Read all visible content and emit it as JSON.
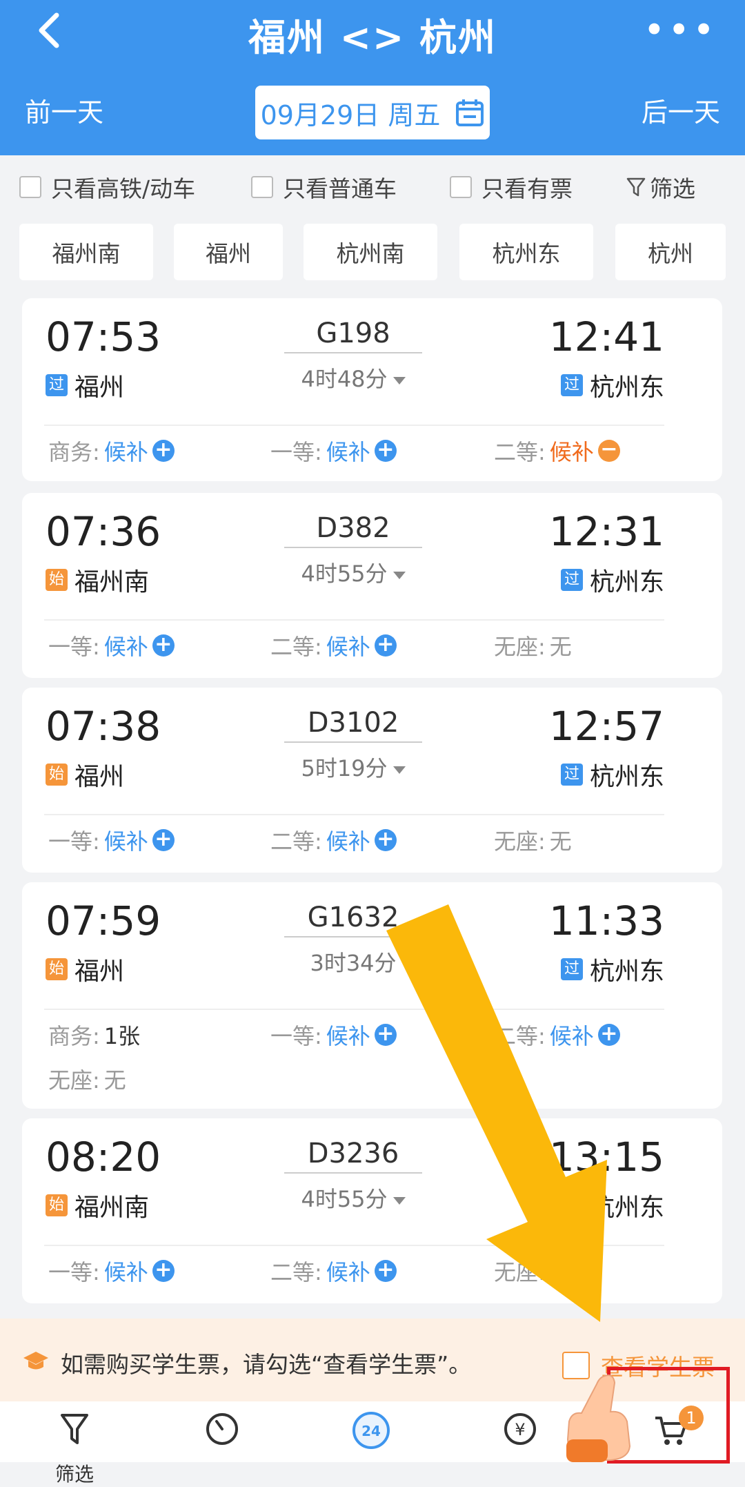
{
  "header": {
    "title": "福州 <> 杭州",
    "prev_day": "前一天",
    "next_day": "后一天",
    "date": "09月29日 周五",
    "accent": "#3d95ee"
  },
  "filters": [
    {
      "label": "只看高铁/动车",
      "checked": false
    },
    {
      "label": "只看普通车",
      "checked": false
    },
    {
      "label": "只看有票",
      "checked": false
    }
  ],
  "filter_button": "筛选",
  "stations": [
    "福州南",
    "福州",
    "杭州南",
    "杭州东",
    "杭州"
  ],
  "trains": [
    {
      "dep_time": "07:53",
      "arr_time": "12:41",
      "train_no": "G198",
      "duration": "4时48分",
      "from_tag": "过",
      "from": "福州",
      "to_tag": "过",
      "to": "杭州东",
      "seats": [
        {
          "label": "商务:",
          "value": "候补",
          "action": "plus"
        },
        {
          "label": "一等:",
          "value": "候补",
          "action": "plus"
        },
        {
          "label": "二等:",
          "value": "候补",
          "action": "minus"
        }
      ]
    },
    {
      "dep_time": "07:36",
      "arr_time": "12:31",
      "train_no": "D382",
      "duration": "4时55分",
      "from_tag": "始",
      "from": "福州南",
      "to_tag": "过",
      "to": "杭州东",
      "seats": [
        {
          "label": "一等:",
          "value": "候补",
          "action": "plus"
        },
        {
          "label": "二等:",
          "value": "候补",
          "action": "plus"
        },
        {
          "label": "无座:",
          "value": "无",
          "action": "none"
        }
      ]
    },
    {
      "dep_time": "07:38",
      "arr_time": "12:57",
      "train_no": "D3102",
      "duration": "5时19分",
      "from_tag": "始",
      "from": "福州",
      "to_tag": "过",
      "to": "杭州东",
      "seats": [
        {
          "label": "一等:",
          "value": "候补",
          "action": "plus"
        },
        {
          "label": "二等:",
          "value": "候补",
          "action": "plus"
        },
        {
          "label": "无座:",
          "value": "无",
          "action": "none"
        }
      ]
    },
    {
      "dep_time": "07:59",
      "arr_time": "11:33",
      "train_no": "G1632",
      "duration": "3时34分",
      "from_tag": "始",
      "from": "福州",
      "to_tag": "过",
      "to": "杭州东",
      "seats": [
        {
          "label": "商务:",
          "value": "1张",
          "action": "none"
        },
        {
          "label": "一等:",
          "value": "候补",
          "action": "plus"
        },
        {
          "label": "二等:",
          "value": "候补",
          "action": "plus"
        },
        {
          "label": "无座:",
          "value": "无",
          "action": "none"
        }
      ]
    },
    {
      "dep_time": "08:20",
      "arr_time": "13:15",
      "train_no": "D3236",
      "duration": "4时55分",
      "from_tag": "始",
      "from": "福州南",
      "to_tag": "过",
      "to": "杭州东",
      "seats": [
        {
          "label": "一等:",
          "value": "候补",
          "action": "plus"
        },
        {
          "label": "二等:",
          "value": "候补",
          "action": "plus"
        },
        {
          "label": "无座:",
          "value": "无",
          "action": "none"
        }
      ]
    }
  ],
  "notice": {
    "text": "如需购买学生票，请勾选“查看学生票”。",
    "checkbox_label": "查看学生票"
  },
  "tabbar": {
    "items": [
      {
        "icon": "filter-icon",
        "label": "筛选"
      },
      {
        "icon": "clock-icon",
        "label": ""
      },
      {
        "icon": "24h-icon",
        "label": ""
      },
      {
        "icon": "yen-icon",
        "label": ""
      },
      {
        "icon": "cart-icon",
        "label": ""
      }
    ],
    "cart_badge": "1"
  }
}
